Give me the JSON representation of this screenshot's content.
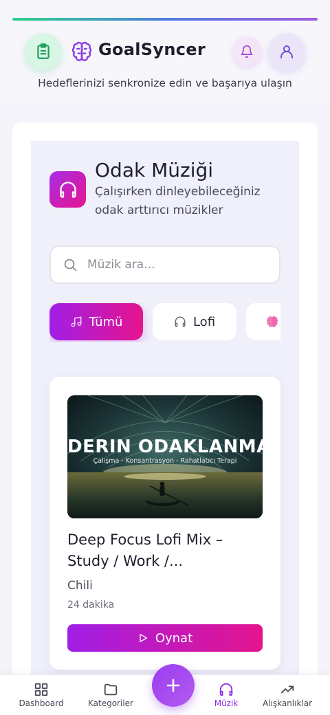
{
  "header": {
    "app_title": "GoalSyncer",
    "tagline": "Hedeflerinizi senkronize edin ve başarıya ulaşın"
  },
  "section": {
    "title": "Odak Müziği",
    "subtitle": "Çalışırken dinleyebileceğiniz odak arttırıcı müzikler"
  },
  "search": {
    "placeholder": "Müzik ara...",
    "value": ""
  },
  "filters": [
    {
      "label": "Tümü",
      "icon": "music-note-icon",
      "selected": true
    },
    {
      "label": "Lofi",
      "icon": "headphones-icon",
      "selected": false
    },
    {
      "label": "",
      "icon": "brain-icon",
      "selected": false
    }
  ],
  "track": {
    "thumb_title": "DERIN ODAKLANMA",
    "thumb_subtitle": "Çalışma - Konsantrasyon - Rahatlatıcı Terapi",
    "title": "Deep Focus Lofi Mix – Study / Work /...",
    "artist": "Chili",
    "duration": "24 dakika",
    "play_label": "Oynat"
  },
  "nav": {
    "dashboard": "Dashboard",
    "categories": "Kategoriler",
    "music": "Müzik",
    "habits": "Alışkanlıklar",
    "active": "music"
  },
  "colors": {
    "accent_start": "#a11fe6",
    "accent_end": "#e4148e",
    "nav_active": "#8f2ce6",
    "fab": "#9a3cf0"
  }
}
